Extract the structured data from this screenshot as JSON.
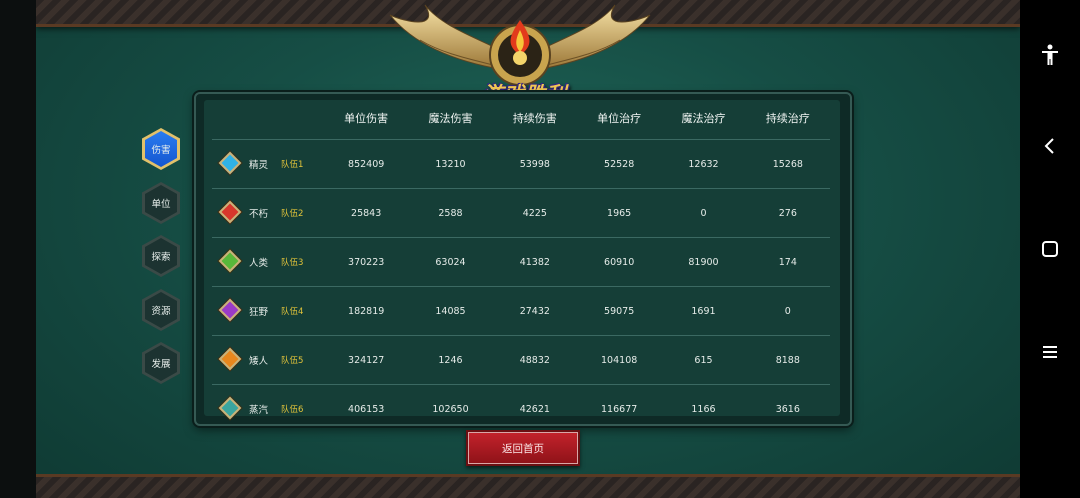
{
  "banner": {
    "title": "游戏胜利"
  },
  "tabs": [
    {
      "label": "伤害",
      "active": true
    },
    {
      "label": "单位",
      "active": false
    },
    {
      "label": "探索",
      "active": false
    },
    {
      "label": "资源",
      "active": false
    },
    {
      "label": "发展",
      "active": false
    }
  ],
  "table": {
    "headers": [
      "单位伤害",
      "魔法伤害",
      "持续伤害",
      "单位治疗",
      "魔法治疗",
      "持续治疗"
    ],
    "rows": [
      {
        "race": "精灵",
        "team": "队伍1",
        "gem_color": "#2fb2e6",
        "values": [
          "852409",
          "13210",
          "53998",
          "52528",
          "12632",
          "15268"
        ]
      },
      {
        "race": "不朽",
        "team": "队伍2",
        "gem_color": "#d8372c",
        "values": [
          "25843",
          "2588",
          "4225",
          "1965",
          "0",
          "276"
        ]
      },
      {
        "race": "人类",
        "team": "队伍3",
        "gem_color": "#58b83a",
        "values": [
          "370223",
          "63024",
          "41382",
          "60910",
          "81900",
          "174"
        ]
      },
      {
        "race": "狂野",
        "team": "队伍4",
        "gem_color": "#9a3bc6",
        "values": [
          "182819",
          "14085",
          "27432",
          "59075",
          "1691",
          "0"
        ]
      },
      {
        "race": "矮人",
        "team": "队伍5",
        "gem_color": "#e8871d",
        "values": [
          "324127",
          "1246",
          "48832",
          "104108",
          "615",
          "8188"
        ]
      },
      {
        "race": "蒸汽",
        "team": "队伍6",
        "gem_color": "#3aa5a0",
        "values": [
          "406153",
          "102650",
          "42621",
          "116677",
          "1166",
          "3616"
        ]
      }
    ]
  },
  "return_button": {
    "label": "返回首页"
  },
  "system_nav": {
    "icons": [
      "accessibility-icon",
      "back-icon",
      "home-icon",
      "menu-icon"
    ]
  }
}
